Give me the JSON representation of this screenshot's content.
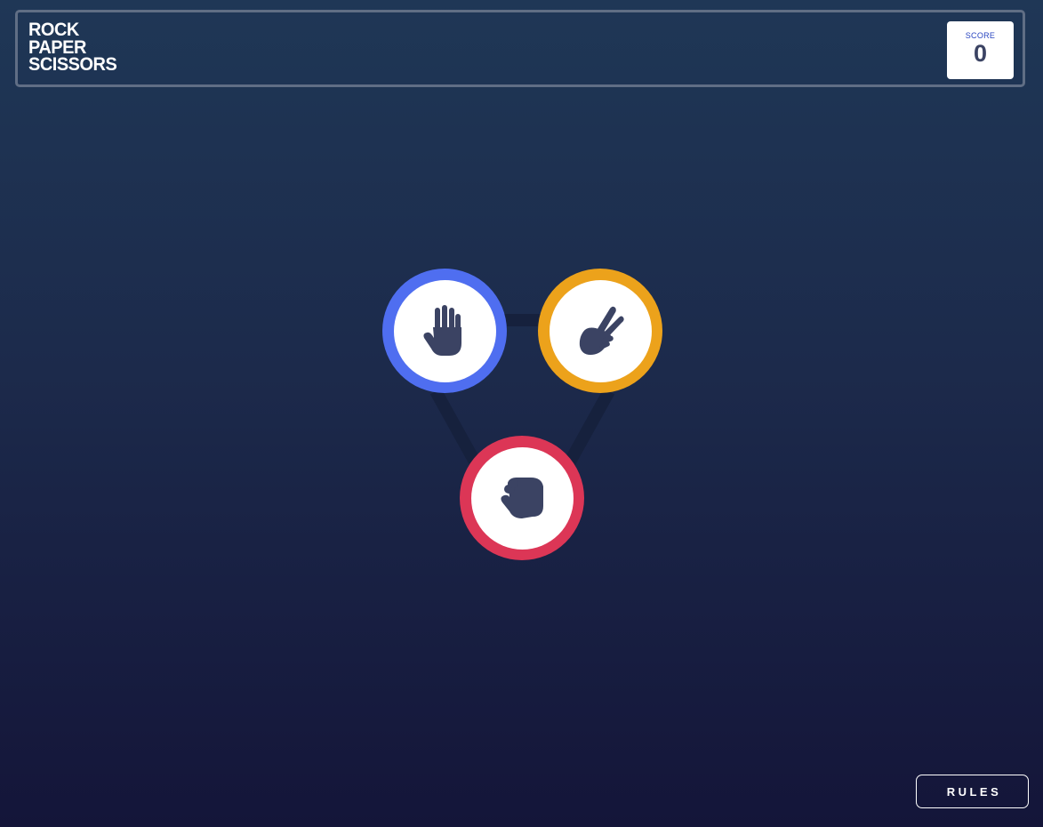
{
  "header": {
    "title_lines": [
      "ROCK",
      "PAPER",
      "SCISSORS"
    ],
    "score_label": "SCORE",
    "score_value": "0"
  },
  "tokens": [
    {
      "name": "paper",
      "icon": "paper-hand-icon",
      "ring_color": "#4f6ef0"
    },
    {
      "name": "scissors",
      "icon": "scissors-hand-icon",
      "ring_color": "#eca21b"
    },
    {
      "name": "rock",
      "icon": "rock-fist-icon",
      "ring_color": "#dc3656"
    }
  ],
  "colors": {
    "background_top": "#1f3756",
    "background_bottom": "#141539",
    "icon": "#3b4363",
    "triangle": "#16213d"
  },
  "footer": {
    "rules_label": "RULES"
  }
}
